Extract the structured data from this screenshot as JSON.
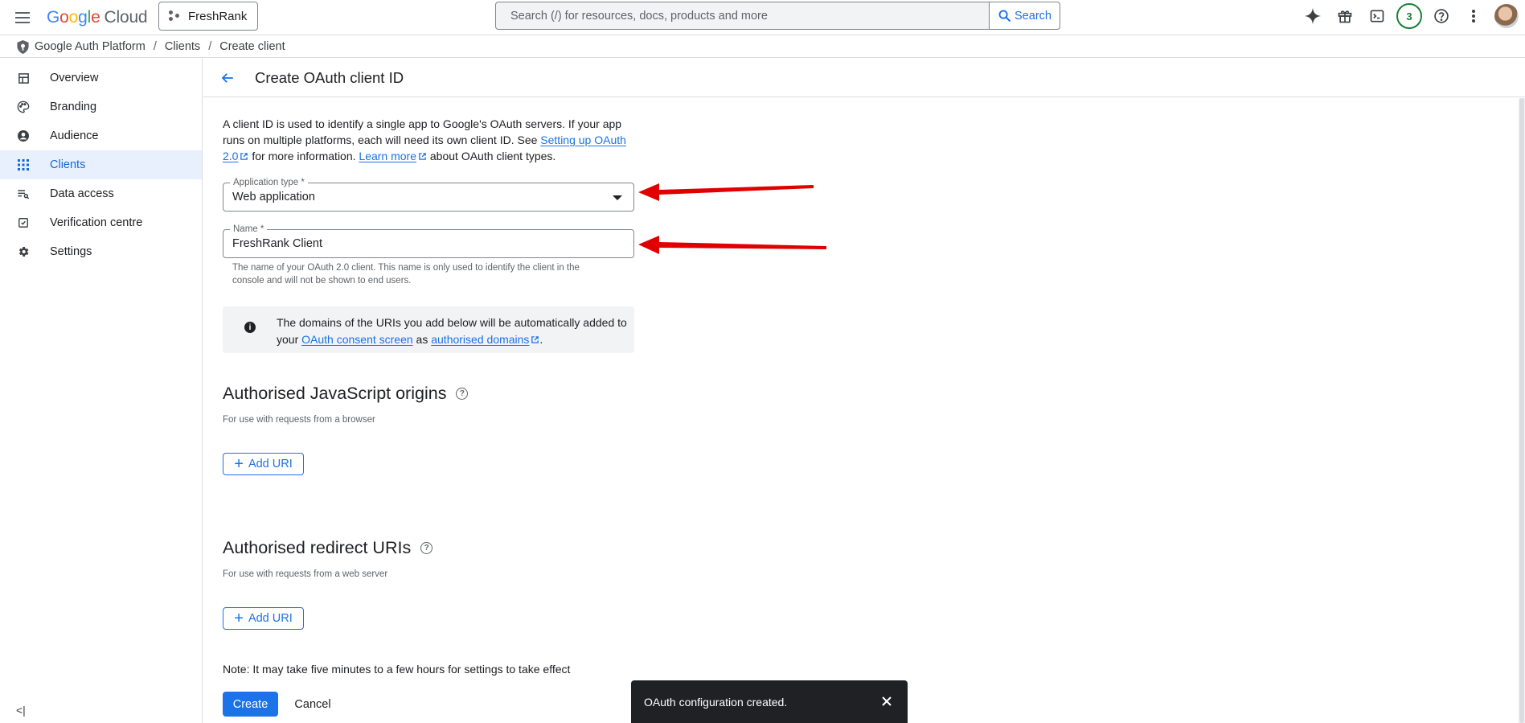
{
  "topbar": {
    "logo_google_letters": [
      "G",
      "o",
      "o",
      "g",
      "l",
      "e"
    ],
    "logo_cloud": "Cloud",
    "project_name": "FreshRank",
    "search_placeholder": "Search (/) for resources, docs, products and more",
    "search_button": "Search",
    "notification_count": "3"
  },
  "breadcrumb": {
    "items": [
      "Google Auth Platform",
      "Clients",
      "Create client"
    ],
    "separator": "/"
  },
  "sidebar": {
    "items": [
      {
        "label": "Overview",
        "icon": "dashboard-icon"
      },
      {
        "label": "Branding",
        "icon": "palette-icon"
      },
      {
        "label": "Audience",
        "icon": "person-icon"
      },
      {
        "label": "Clients",
        "icon": "grid-icon",
        "active": true
      },
      {
        "label": "Data access",
        "icon": "data-access-icon"
      },
      {
        "label": "Verification centre",
        "icon": "checklist-icon"
      },
      {
        "label": "Settings",
        "icon": "gear-icon"
      }
    ],
    "collapse_label": "<|"
  },
  "page": {
    "title": "Create OAuth client ID",
    "intro_1": "A client ID is used to identify a single app to Google's OAuth servers. If your app runs on multiple platforms, each will need its own client ID. See ",
    "intro_link_1": "Setting up OAuth 2.0",
    "intro_2": " for more information. ",
    "intro_link_2": "Learn more",
    "intro_3": " about OAuth client types."
  },
  "form": {
    "app_type_label": "Application type *",
    "app_type_value": "Web application",
    "name_label": "Name *",
    "name_value": "FreshRank Client",
    "name_hint": "The name of your OAuth 2.0 client. This name is only used to identify the client in the console and will not be shown to end users."
  },
  "info": {
    "text_1": "The domains of the URIs you add below will be automatically added to your ",
    "link_1": "OAuth consent screen",
    "text_2": " as ",
    "link_2": "authorised domains",
    "text_3": "."
  },
  "js_origins": {
    "title": "Authorised JavaScript origins",
    "subtitle": "For use with requests from a browser",
    "add_label": "Add URI"
  },
  "redirect_uris": {
    "title": "Authorised redirect URIs",
    "subtitle": "For use with requests from a web server",
    "add_label": "Add URI"
  },
  "footer": {
    "note": "Note: It may take five minutes to a few hours for settings to take effect",
    "create_label": "Create",
    "cancel_label": "Cancel"
  },
  "snackbar": {
    "message": "OAuth configuration created."
  },
  "colors": {
    "primary": "#1a73e8",
    "active_bg": "#e8f0fe",
    "annotation_red": "#e00000",
    "snackbar_bg": "#202124"
  }
}
